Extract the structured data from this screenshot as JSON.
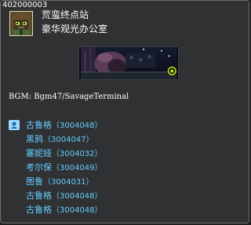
{
  "map": {
    "id": "402000003",
    "street_name": "荒蛮终点站",
    "map_name": "豪华观光办公室",
    "bgm_label": "BGM: Bgm47/SavageTerminal"
  },
  "icons": {
    "map_icon": "npc-face-icon",
    "npc_icon": "person-bubble-icon"
  },
  "colors": {
    "tooltip_bg": "#2f3133",
    "npc_text": "#66ccff",
    "text": "#ffffff"
  },
  "npcs": [
    {
      "name": "古鲁格",
      "id": "（3004048）"
    },
    {
      "name": "黑鸦",
      "id": "（3004047）"
    },
    {
      "name": "塞妮娅",
      "id": "（3004032）"
    },
    {
      "name": "考尔保",
      "id": "（3004049）"
    },
    {
      "name": "图鲁",
      "id": "（3004031）"
    },
    {
      "name": "古鲁格",
      "id": "（3004048）"
    },
    {
      "name": "古鲁格",
      "id": "（3004048）"
    }
  ]
}
